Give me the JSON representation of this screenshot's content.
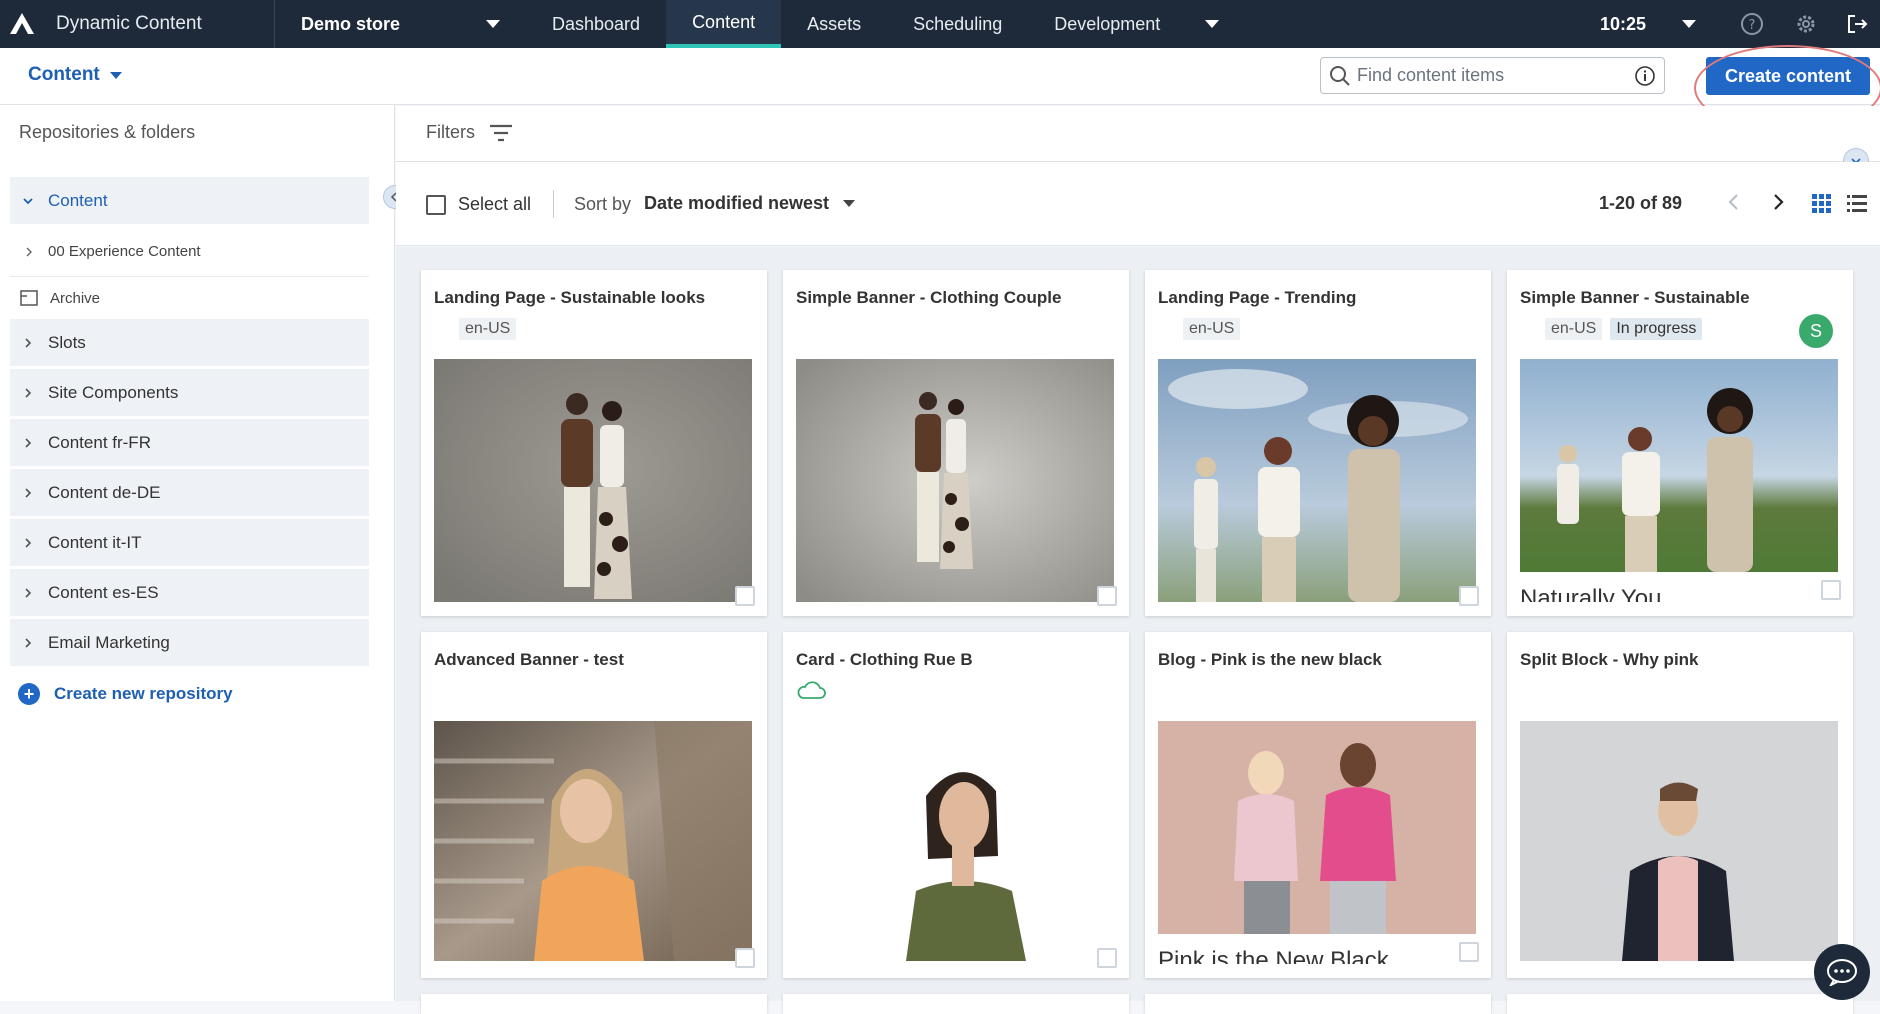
{
  "app": {
    "name": "Dynamic Content",
    "store": "Demo store",
    "time": "10:25"
  },
  "nav": {
    "tabs": [
      "Dashboard",
      "Content",
      "Assets",
      "Scheduling",
      "Development"
    ],
    "active": "Content"
  },
  "subbar": {
    "context_label": "Content",
    "search_placeholder": "Find content items",
    "create_label": "Create content"
  },
  "sidebar": {
    "title": "Repositories & folders",
    "open_repo": "Content",
    "open_repo_children": [
      "00 Experience Content"
    ],
    "archive_label": "Archive",
    "repos": [
      "Slots",
      "Site Components",
      "Content fr-FR",
      "Content de-DE",
      "Content it-IT",
      "Content es-ES",
      "Email Marketing"
    ],
    "new_repo_label": "Create new repository"
  },
  "filters": {
    "label": "Filters"
  },
  "toolbar": {
    "select_all": "Select all",
    "sort_label": "Sort by",
    "sort_value": "Date modified newest",
    "pagination": "1-20 of 89"
  },
  "cards": [
    {
      "title": "Landing Page - Sustainable looks",
      "locale": "en-US",
      "status": "",
      "avatar": ""
    },
    {
      "title": "Simple Banner - Clothing Couple",
      "locale": "",
      "status": "",
      "avatar": ""
    },
    {
      "title": "Landing Page - Trending",
      "locale": "en-US",
      "status": "",
      "avatar": ""
    },
    {
      "title": "Simple Banner - Sustainable",
      "locale": "en-US",
      "status": "In progress",
      "avatar": "S",
      "caption": "Naturally You"
    },
    {
      "title": "Advanced Banner - test",
      "locale": "",
      "status": "",
      "avatar": ""
    },
    {
      "title": "Card - Clothing Rue B",
      "locale": "",
      "status": "",
      "avatar": ""
    },
    {
      "title": "Blog - Pink is the new black",
      "locale": "",
      "status": "",
      "avatar": "",
      "caption": "Pink is the New Black"
    },
    {
      "title": "Split Block - Why pink",
      "locale": "",
      "status": "",
      "avatar": ""
    }
  ],
  "colors": {
    "topbar": "#1e2a3a",
    "accent": "#2167c6",
    "active_tab_underline": "#2ec4b6",
    "annotation_circle": "#e07a7a"
  }
}
